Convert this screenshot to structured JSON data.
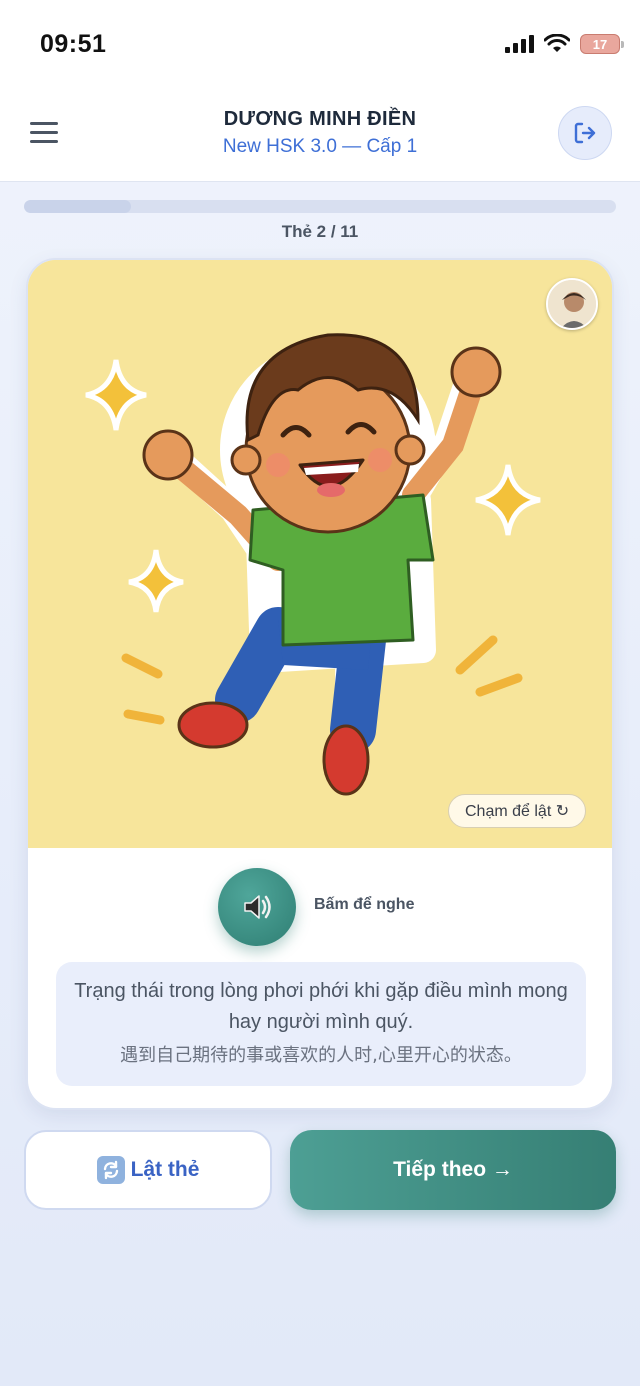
{
  "status_bar": {
    "time": "09:51",
    "battery": "17"
  },
  "header": {
    "title": "DƯƠNG MINH ĐIỀN",
    "subtitle": "New HSK 3.0 — Cấp 1"
  },
  "progress": {
    "current": 2,
    "total": 11,
    "label": "Thẻ 2 / 11",
    "fraction": 0.18
  },
  "card": {
    "flip_hint": "Chạm để lật ↻",
    "speak_label": "Bấm để nghe",
    "meaning_vi": "Trạng thái trong lòng phơi phới khi gặp điều mình mong hay người mình quý.",
    "meaning_zh": "遇到自己期待的事或喜欢的人时,心里开心的状态。",
    "image_accent": "#f7e59b"
  },
  "buttons": {
    "flip_label": "Lật thẻ",
    "next_label": "Tiếp theo →"
  },
  "icons": {
    "menu": "menu-icon",
    "logout": "logout-icon",
    "speaker": "speaker-icon",
    "flip": "flip-icon"
  },
  "colors": {
    "accent_blue": "#3e6fd6",
    "accent_teal": "#3e8f84"
  }
}
